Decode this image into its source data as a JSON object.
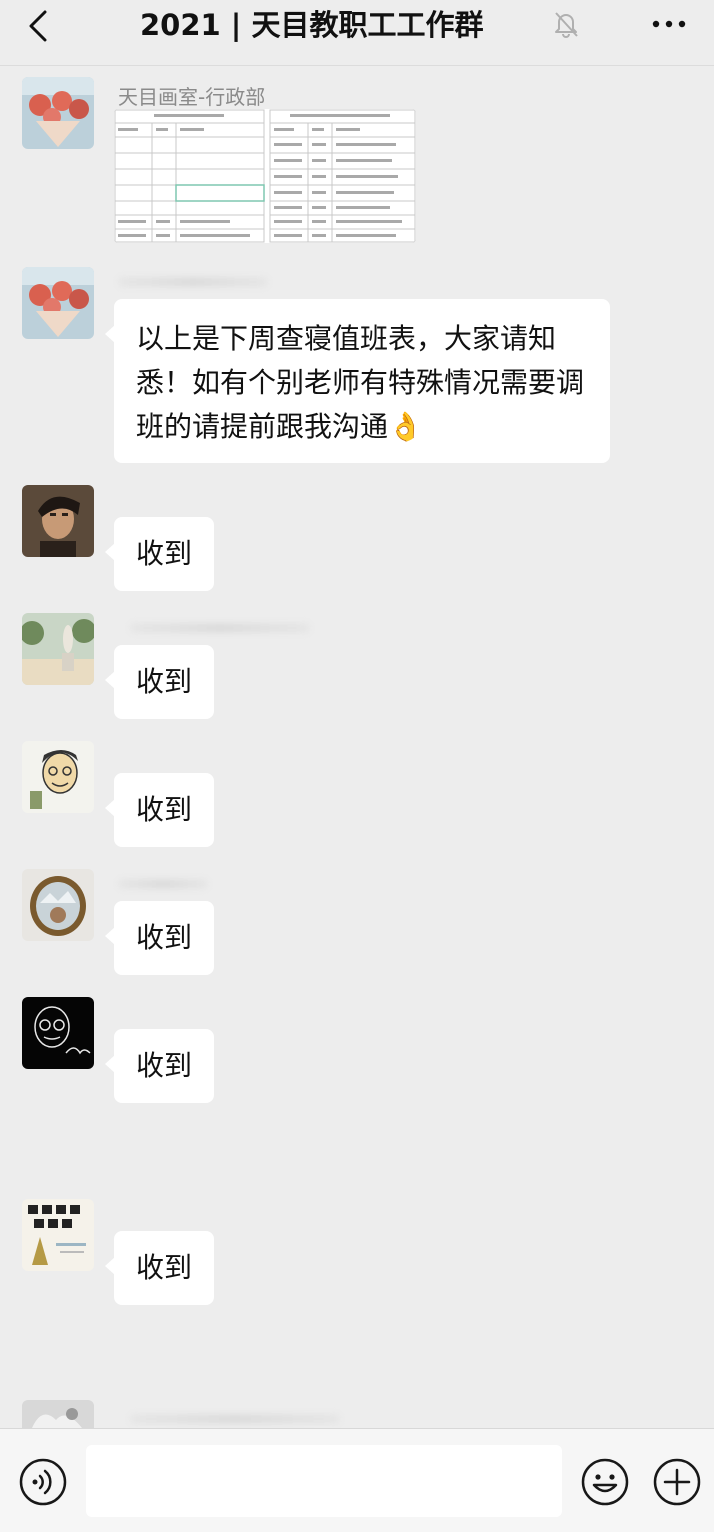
{
  "header": {
    "title": "2021 | 天目教职工工作群",
    "back_icon": "chevron-left-icon",
    "mute_icon": "bell-off-icon",
    "more_icon": "more-dots-icon"
  },
  "messages": [
    {
      "sender": "天目画室-行政部",
      "type": "image",
      "content": "timetable-screenshot"
    },
    {
      "sender": "",
      "type": "text",
      "text": "以上是下周查寝值班表，大家请知悉！如有个别老师有特殊情况需要调班的请提前跟我沟通👌"
    },
    {
      "sender": "",
      "type": "text",
      "text": "收到"
    },
    {
      "sender": "",
      "type": "text",
      "text": "收到"
    },
    {
      "sender": "",
      "type": "text",
      "text": "收到"
    },
    {
      "sender": "",
      "type": "text",
      "text": "收到"
    },
    {
      "sender": "",
      "type": "text",
      "text": "收到"
    },
    {
      "sender": "",
      "type": "text",
      "text": "收到"
    }
  ],
  "input_bar": {
    "voice_icon": "voice-icon",
    "text_value": "",
    "emoji_icon": "emoji-icon",
    "plus_icon": "plus-circle-icon"
  },
  "colors": {
    "background": "#ededed",
    "bubble": "#ffffff",
    "sender_gray": "#8a8a8a",
    "input_bar": "#f6f6f6"
  }
}
